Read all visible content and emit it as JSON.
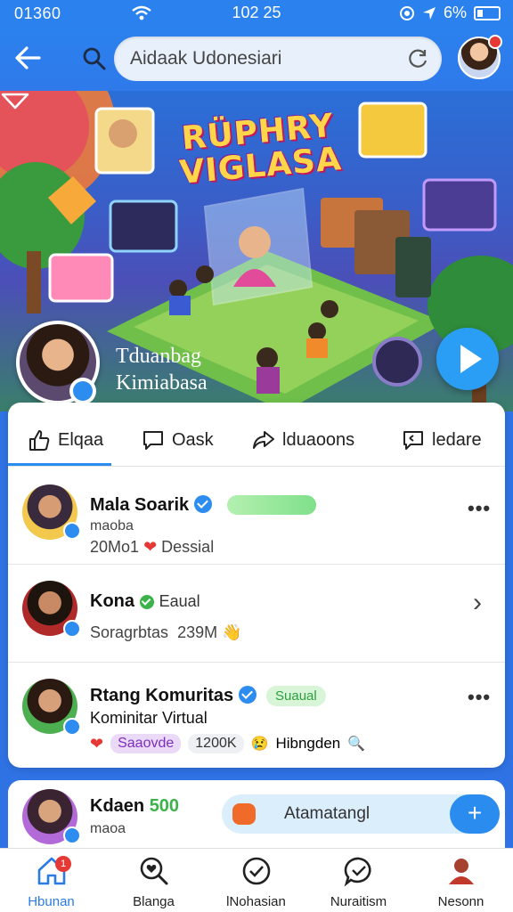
{
  "status": {
    "carrier": "01360",
    "time": "102 25",
    "battery": "6%"
  },
  "header": {
    "search_value": "Aidaak Udonesiari"
  },
  "hero": {
    "title_line1": "RÜPHRY",
    "title_line2": "VIGLASA",
    "profile_line1": "Tduanbag",
    "profile_line2": "Kimiabasa"
  },
  "tabs": [
    {
      "label": "Elqaa"
    },
    {
      "label": "Oask"
    },
    {
      "label": "lduaoons"
    },
    {
      "label": "ledare"
    }
  ],
  "feed": [
    {
      "name": "Mala Soarik",
      "line1": "maoba",
      "line2_a": "20Mo1",
      "line2_b": "Dessial"
    },
    {
      "name": "Kona",
      "tag": "Eaual",
      "line2_a": "Soragrbtas",
      "line2_b": "239M"
    },
    {
      "name": "Rtang Komuritas",
      "tag": "Suaual",
      "line1": "Kominitar Virtual",
      "pill1": "Saaovde",
      "pill2": "1200K",
      "line2_b": "Hibngden"
    },
    {
      "name": "Kdaen",
      "tag": "500",
      "line1": "maoa"
    }
  ],
  "composer": {
    "text": "Atamatangl",
    "send_icon": "+"
  },
  "nav": [
    {
      "label": "Hbunan",
      "badge": "1"
    },
    {
      "label": "Blanga"
    },
    {
      "label": "lNohasian"
    },
    {
      "label": "Nuraitism"
    },
    {
      "label": "Nesonn"
    }
  ],
  "colors": {
    "primary": "#2a8cee",
    "verified": "#2d8cf0",
    "badge": "#e53935"
  }
}
